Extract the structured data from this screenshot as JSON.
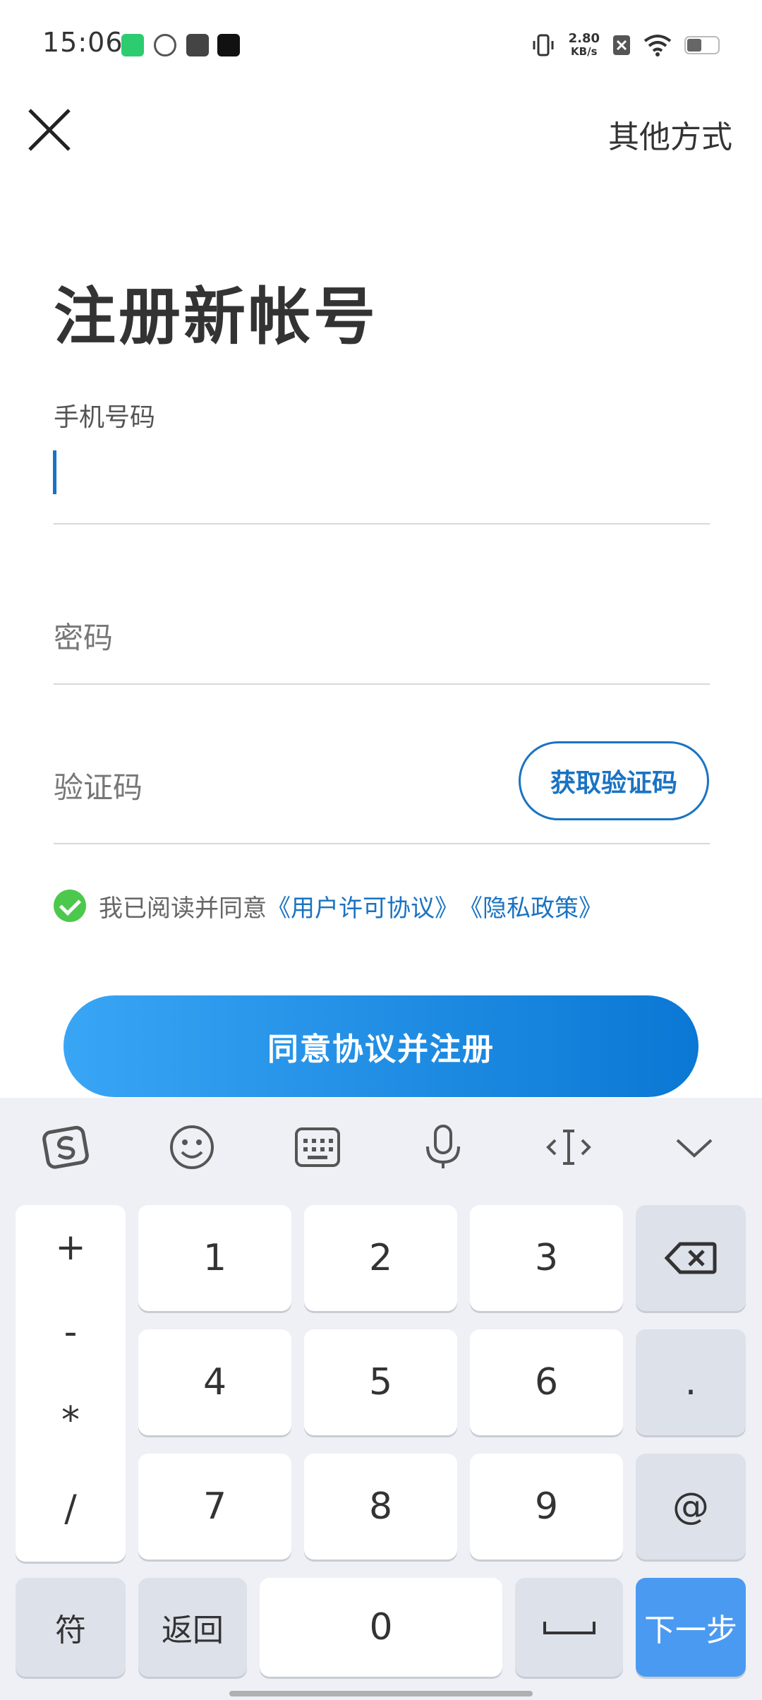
{
  "status_bar": {
    "time": "15:06",
    "net_speed_value": "2.80",
    "net_speed_unit": "KB/s"
  },
  "nav": {
    "other_methods": "其他方式"
  },
  "page": {
    "title": "注册新帐号"
  },
  "form": {
    "phone_label": "手机号码",
    "password_placeholder": "密码",
    "code_placeholder": "验证码",
    "get_code_label": "获取验证码"
  },
  "agreement": {
    "prefix": "我已阅读并同意",
    "license_link": "《用户许可协议》",
    "privacy_link": "《隐私政策》"
  },
  "register_button": "同意协议并注册",
  "keyboard": {
    "symbols": [
      "+",
      "-",
      "*",
      "/"
    ],
    "digits": [
      "1",
      "2",
      "3",
      "4",
      "5",
      "6",
      "7",
      "8",
      "9",
      "0"
    ],
    "dot": ".",
    "at": "@",
    "fu": "符",
    "back": "返回",
    "next": "下一步"
  },
  "colors": {
    "accent": "#1a73c2",
    "agree_check": "#4cc84c",
    "next_key": "#4a9af2"
  }
}
